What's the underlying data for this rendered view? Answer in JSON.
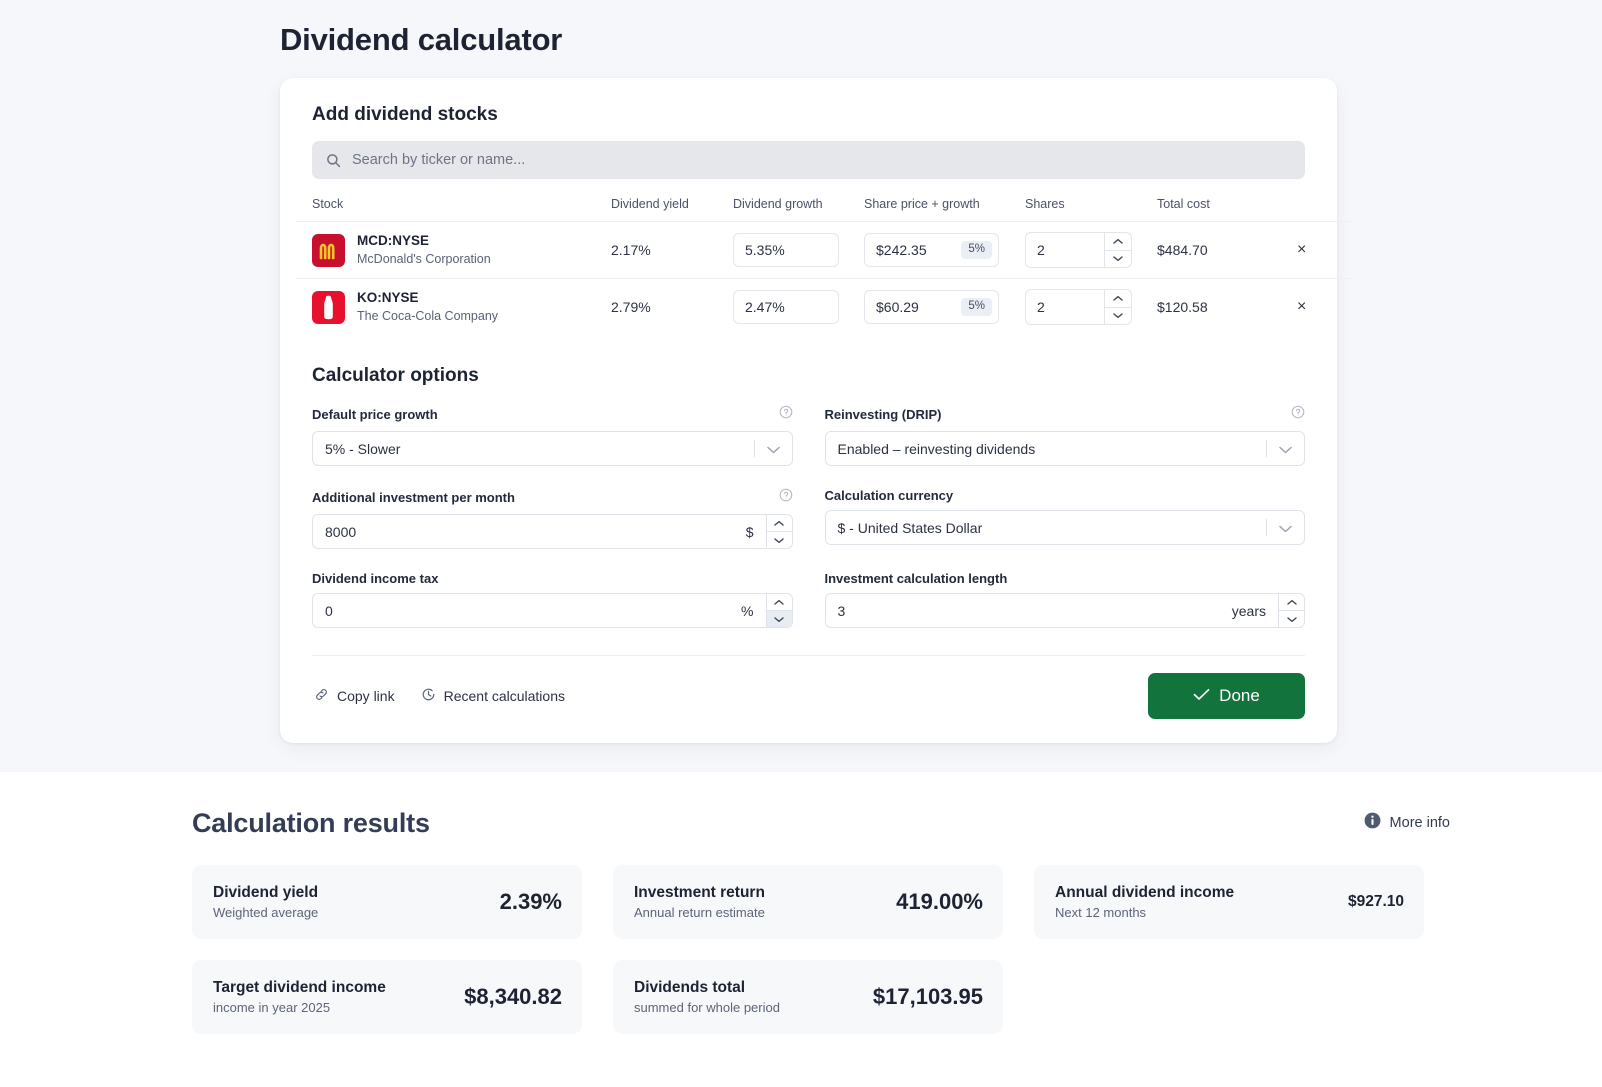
{
  "page": {
    "title": "Dividend calculator"
  },
  "add_stocks": {
    "title": "Add dividend stocks",
    "search_placeholder": "Search by ticker or name...",
    "columns": {
      "stock": "Stock",
      "dividend_yield": "Dividend yield",
      "dividend_growth": "Dividend growth",
      "share_price_growth": "Share price + growth",
      "shares": "Shares",
      "total_cost": "Total cost"
    },
    "rows": [
      {
        "ticker": "MCD:NYSE",
        "company": "McDonald's Corporation",
        "logo": "mcdonalds-logo",
        "dividend_yield": "2.17%",
        "dividend_growth": "5.35%",
        "share_price": "$242.35",
        "price_growth_badge": "5%",
        "shares": "2",
        "total_cost": "$484.70",
        "remove_label": "×"
      },
      {
        "ticker": "KO:NYSE",
        "company": "The Coca-Cola Company",
        "logo": "cocacola-logo",
        "dividend_yield": "2.79%",
        "dividend_growth": "2.47%",
        "share_price": "$60.29",
        "price_growth_badge": "5%",
        "shares": "2",
        "total_cost": "$120.58",
        "remove_label": "×"
      }
    ]
  },
  "options": {
    "title": "Calculator options",
    "default_price_growth": {
      "label": "Default price growth",
      "value": "5% - Slower",
      "has_help": true
    },
    "reinvesting": {
      "label": "Reinvesting (DRIP)",
      "value": "Enabled – reinvesting dividends",
      "has_help": true
    },
    "additional_investment": {
      "label": "Additional investment per month",
      "value": "8000",
      "unit": "$",
      "has_help": true
    },
    "calculation_currency": {
      "label": "Calculation currency",
      "value": "$ - United States Dollar",
      "has_help": false
    },
    "dividend_income_tax": {
      "label": "Dividend income tax",
      "value": "0",
      "unit": "%",
      "has_help": false
    },
    "investment_length": {
      "label": "Investment calculation length",
      "value": "3",
      "unit": "years",
      "has_help": false
    }
  },
  "footer": {
    "copy_link": "Copy link",
    "recent_calculations": "Recent calculations",
    "done": "Done"
  },
  "results": {
    "title": "Calculation results",
    "more_info": "More info",
    "cards": [
      {
        "label": "Dividend yield",
        "sub": "Weighted average",
        "value": "2.39%"
      },
      {
        "label": "Investment return",
        "sub": "Annual return estimate",
        "value": "419.00%"
      },
      {
        "label": "Annual dividend income",
        "sub": "Next 12 months",
        "value": "$927.10"
      },
      {
        "label": "Target dividend income",
        "sub": "income in year 2025",
        "value": "$8,340.82"
      },
      {
        "label": "Dividends total",
        "sub": "summed for whole period",
        "value": "$17,103.95"
      }
    ]
  },
  "colors": {
    "page_bg": "#f5f7fa",
    "card_bg": "#ffffff",
    "accent_green": "#12733d",
    "mcd_red": "#c8102e",
    "ko_red": "#e8112d",
    "result_card_bg": "#f7f8fa"
  }
}
